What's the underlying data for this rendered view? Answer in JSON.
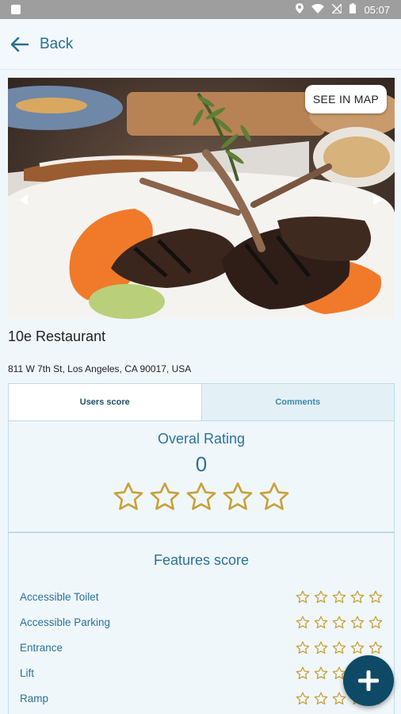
{
  "status_bar": {
    "time": "05:07"
  },
  "app_bar": {
    "back_label": "Back"
  },
  "hero": {
    "see_in_map": "SEE IN MAP"
  },
  "restaurant": {
    "name": "10e Restaurant",
    "address": "811 W 7th St, Los Angeles, CA 90017, USA"
  },
  "tabs": [
    {
      "label": "Users score",
      "active": true
    },
    {
      "label": "Comments",
      "active": false
    }
  ],
  "overall": {
    "title": "Overal Rating",
    "value": "0",
    "stars": 0,
    "max_stars": 5
  },
  "features": {
    "title": "Features score",
    "items": [
      {
        "label": "Accessible Toilet",
        "stars": 0
      },
      {
        "label": "Accessible Parking",
        "stars": 0
      },
      {
        "label": "Entrance",
        "stars": 0
      },
      {
        "label": "Lift",
        "stars": 0
      },
      {
        "label": "Ramp",
        "stars": 0
      }
    ]
  },
  "colors": {
    "accent": "#2a7299",
    "star": "#c8a23a",
    "fab": "#0e4a66"
  }
}
